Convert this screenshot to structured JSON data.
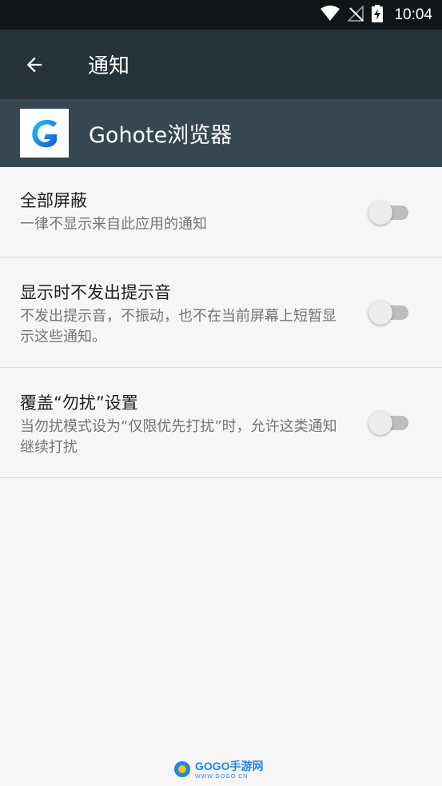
{
  "status_bar": {
    "time": "10:04"
  },
  "app_bar": {
    "title": "通知"
  },
  "app_header": {
    "name": "Gohote浏览器",
    "icon_letter": "G"
  },
  "settings": [
    {
      "title": "全部屏蔽",
      "summary": "一律不显示来自此应用的通知",
      "enabled": false
    },
    {
      "title": "显示时不发出提示音",
      "summary": "不发出提示音，不振动，也不在当前屏幕上短暂显示这些通知。",
      "enabled": false
    },
    {
      "title": "覆盖“勿扰”设置",
      "summary": "当勿扰模式设为“仅限优先打扰”时，允许这类通知继续打扰",
      "enabled": false
    }
  ],
  "watermark": {
    "text": "GOGO手游网",
    "url": "WWW.GOGO.CN"
  },
  "colors": {
    "status_bar": "#111416",
    "app_bar": "#263238",
    "app_header": "#37474f",
    "background": "#f6f6f6"
  }
}
